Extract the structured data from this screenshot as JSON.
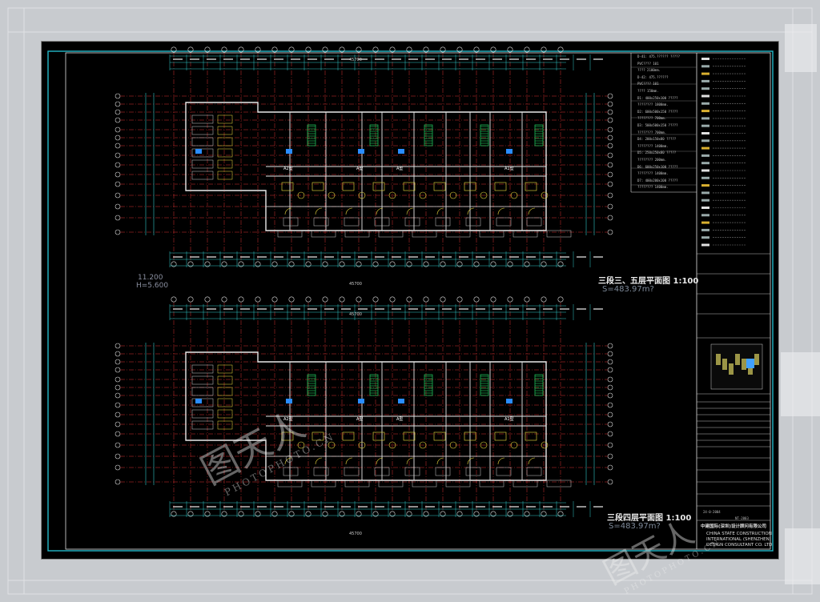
{
  "drawing": {
    "upper_plan_title": "三段三、五层平面图 1:100",
    "upper_plan_area": "S=483.97m?",
    "lower_plan_title": "三段四层平面图 1:100",
    "lower_plan_area": "S=483.97m?",
    "elevation_value": "11.200",
    "elevation_height": "H=5.600",
    "unit_labels": [
      "A2型",
      "A型",
      "A型",
      "A1型"
    ],
    "overall_dimension": "45700"
  },
  "notes": {
    "lines": [
      "D-41: 475.?????? ?????",
      "PVC????  101",
      "????  2100mm.",
      "D-42: 475.??????",
      "PVC????  101",
      "????  150mm.",
      "D1: 400x250x100 ?????",
      "????????  1800mm.",
      "D2: 600x500x150 ?????",
      "????????  700mm.",
      "D3: 500x500x150 ?????",
      "????????  700mm.",
      "D4: 200x150x80 ?????",
      "????????  1400mm.",
      "D5: 250x250x80 ?????",
      "????????  200mm.",
      "D6: 600x250x100 ?????",
      "????????  1400mm.",
      "D7: 400x200x100 ?????",
      "????????  1400mm."
    ]
  },
  "title_block": {
    "company_cn": "中建国际(深圳)设计顾问有限公司",
    "company_en_1": "CHINA STATE CONSTRUCTION",
    "company_en_2": "INTERNATIONAL (SHENZHEN)",
    "company_en_3": "DESIGN CONSULTANT CO. LTD",
    "date": "24-0-2004",
    "drawing_no": "NT-2003"
  },
  "watermark": {
    "brand": "图天人",
    "site": "PHOTOPHOTO.CN"
  },
  "colors": {
    "grid_line": "#d83030",
    "wall": "#e8e8e8",
    "dimension": "#30c8c8",
    "furniture": "#f0e040",
    "stair": "#20d060",
    "tag": "#2a8cff",
    "border": "#22b8c8"
  }
}
